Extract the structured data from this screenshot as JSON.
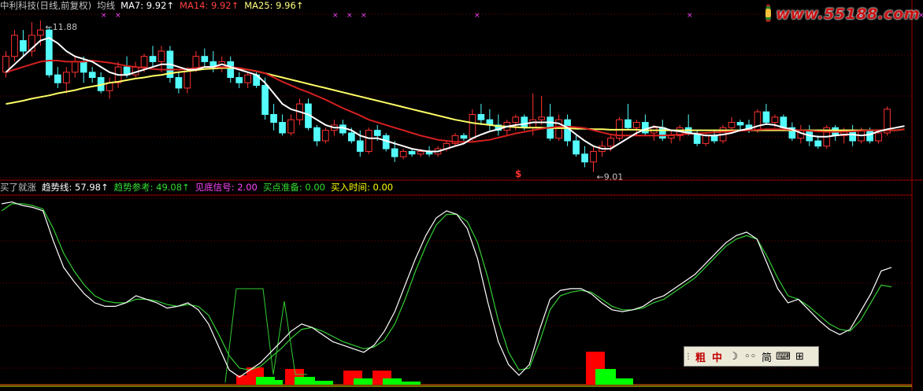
{
  "main_legend": [
    {
      "text": "中利科技(日线,前复权)",
      "color": "#c0c0c0"
    },
    {
      "text": "均线",
      "color": "#c0c0c0"
    },
    {
      "text": "MA7: 9.92↑",
      "color": "#ffffff"
    },
    {
      "text": "MA14: 9.92↑",
      "color": "#ff4040"
    },
    {
      "text": "MA25: 9.96↑",
      "color": "#ffff80"
    }
  ],
  "indicator_legend": [
    {
      "text": "买了就涨",
      "color": "#c0c0c0"
    },
    {
      "text": "趋势线: 57.98↑",
      "color": "#ffffff"
    },
    {
      "text": "趋势参考: 49.08↑",
      "color": "#33dd33"
    },
    {
      "text": "见底信号: 2.00",
      "color": "#ff44ff"
    },
    {
      "text": "买点准备: 0.00",
      "color": "#33dd33"
    },
    {
      "text": "买入时间: 0.00",
      "color": "#ffff00"
    }
  ],
  "annotations": {
    "high": "11.88",
    "low": "9.01",
    "signal_marker": "$"
  },
  "watermark": {
    "text": "www.55188.com"
  },
  "ime_bar": {
    "items": [
      "⋮",
      "粗",
      "中",
      "☽",
      "◦◦",
      "简",
      "⌨",
      "⊞"
    ]
  },
  "colors": {
    "up": "#ff3232",
    "down": "#54fcfc",
    "ma7": "#ffffff",
    "ma14": "#d42020",
    "ma25": "#ffff66",
    "trend": "#ffffff",
    "trend_ref": "#33cc33",
    "grid": "#7a0000",
    "signal": "#ff44ff",
    "bar_red": "#ff0000",
    "bar_green": "#00ff00"
  },
  "chart_data": [
    {
      "type": "candlestick",
      "title": "中利科技(日线,前复权)",
      "ylim": [
        8.9,
        12.0
      ],
      "candles": [
        [
          10.9,
          11.3,
          10.8,
          11.2
        ],
        [
          11.2,
          11.7,
          11.1,
          11.6
        ],
        [
          11.5,
          11.7,
          11.2,
          11.3
        ],
        [
          11.3,
          11.85,
          11.2,
          11.6
        ],
        [
          11.6,
          11.88,
          11.4,
          11.7
        ],
        [
          11.7,
          11.75,
          10.8,
          10.85
        ],
        [
          10.85,
          11.0,
          10.6,
          10.7
        ],
        [
          10.7,
          11.0,
          10.5,
          10.9
        ],
        [
          10.9,
          11.2,
          10.8,
          11.1
        ],
        [
          11.1,
          11.2,
          10.7,
          10.9
        ],
        [
          10.9,
          11.0,
          10.7,
          10.8
        ],
        [
          10.8,
          10.9,
          10.5,
          10.55
        ],
        [
          10.55,
          10.8,
          10.4,
          10.7
        ],
        [
          10.7,
          11.1,
          10.6,
          11.0
        ],
        [
          11.0,
          11.2,
          10.8,
          10.85
        ],
        [
          10.85,
          11.1,
          10.8,
          11.0
        ],
        [
          11.0,
          11.25,
          10.9,
          11.2
        ],
        [
          11.2,
          11.4,
          11.0,
          11.1
        ],
        [
          11.1,
          11.4,
          10.9,
          11.3
        ],
        [
          11.3,
          11.4,
          10.7,
          10.8
        ],
        [
          10.8,
          10.9,
          10.5,
          10.6
        ],
        [
          10.6,
          11.0,
          10.5,
          10.95
        ],
        [
          10.95,
          11.3,
          10.9,
          11.2
        ],
        [
          11.2,
          11.35,
          11.0,
          11.1
        ],
        [
          11.1,
          11.3,
          10.9,
          11.0
        ],
        [
          11.0,
          11.2,
          10.9,
          11.1
        ],
        [
          11.1,
          11.2,
          10.7,
          10.8
        ],
        [
          10.8,
          10.9,
          10.6,
          10.7
        ],
        [
          10.7,
          10.9,
          10.6,
          10.85
        ],
        [
          10.85,
          10.9,
          10.6,
          10.65
        ],
        [
          10.65,
          10.8,
          10.0,
          10.1
        ],
        [
          10.1,
          10.3,
          9.8,
          9.95
        ],
        [
          9.95,
          10.1,
          9.7,
          9.75
        ],
        [
          9.75,
          10.1,
          9.7,
          10.0
        ],
        [
          10.0,
          10.4,
          9.9,
          10.3
        ],
        [
          10.3,
          10.4,
          9.8,
          9.85
        ],
        [
          9.85,
          9.9,
          9.5,
          9.6
        ],
        [
          9.6,
          9.85,
          9.55,
          9.8
        ],
        [
          9.8,
          10.0,
          9.7,
          9.9
        ],
        [
          9.9,
          10.0,
          9.7,
          9.75
        ],
        [
          9.75,
          9.85,
          9.55,
          9.6
        ],
        [
          9.6,
          9.8,
          9.3,
          9.4
        ],
        [
          9.4,
          9.85,
          9.35,
          9.8
        ],
        [
          9.8,
          9.9,
          9.6,
          9.7
        ],
        [
          9.7,
          9.75,
          9.4,
          9.45
        ],
        [
          9.45,
          9.6,
          9.2,
          9.3
        ],
        [
          9.3,
          9.45,
          9.25,
          9.4
        ],
        [
          9.4,
          9.45,
          9.3,
          9.35
        ],
        [
          9.35,
          9.45,
          9.3,
          9.4
        ],
        [
          9.4,
          9.5,
          9.3,
          9.35
        ],
        [
          9.35,
          9.5,
          9.3,
          9.45
        ],
        [
          9.45,
          9.6,
          9.4,
          9.55
        ],
        [
          9.55,
          9.75,
          9.5,
          9.7
        ],
        [
          9.7,
          9.75,
          9.6,
          9.65
        ],
        [
          9.65,
          10.2,
          9.6,
          10.1
        ],
        [
          10.1,
          10.3,
          9.9,
          10.0
        ],
        [
          10.0,
          10.2,
          9.8,
          9.9
        ],
        [
          9.9,
          10.1,
          9.7,
          9.8
        ],
        [
          9.8,
          10.0,
          9.7,
          9.95
        ],
        [
          9.95,
          10.1,
          9.8,
          10.05
        ],
        [
          10.05,
          10.1,
          9.8,
          9.85
        ],
        [
          9.85,
          10.5,
          9.7,
          10.0
        ],
        [
          10.0,
          10.45,
          9.9,
          10.05
        ],
        [
          10.05,
          10.3,
          9.6,
          9.65
        ],
        [
          9.65,
          10.1,
          9.6,
          10.0
        ],
        [
          10.0,
          10.1,
          9.5,
          9.6
        ],
        [
          9.6,
          9.7,
          9.3,
          9.35
        ],
        [
          9.35,
          9.5,
          9.1,
          9.2
        ],
        [
          9.2,
          9.5,
          9.01,
          9.4
        ],
        [
          9.4,
          9.6,
          9.3,
          9.5
        ],
        [
          9.5,
          9.7,
          9.4,
          9.65
        ],
        [
          9.65,
          10.05,
          9.6,
          10.0
        ],
        [
          10.0,
          10.3,
          9.8,
          9.85
        ],
        [
          9.85,
          10.0,
          9.7,
          9.95
        ],
        [
          9.95,
          10.1,
          9.7,
          9.75
        ],
        [
          9.75,
          9.9,
          9.6,
          9.85
        ],
        [
          9.85,
          10.0,
          9.6,
          9.65
        ],
        [
          9.65,
          9.8,
          9.55,
          9.7
        ],
        [
          9.7,
          9.9,
          9.6,
          9.85
        ],
        [
          9.85,
          10.1,
          9.7,
          9.75
        ],
        [
          9.75,
          9.8,
          9.5,
          9.55
        ],
        [
          9.55,
          9.75,
          9.5,
          9.7
        ],
        [
          9.7,
          9.8,
          9.55,
          9.6
        ],
        [
          9.6,
          9.9,
          9.55,
          9.85
        ],
        [
          9.85,
          10.05,
          9.8,
          9.95
        ],
        [
          9.95,
          10.0,
          9.8,
          9.9
        ],
        [
          9.9,
          10.0,
          9.75,
          9.8
        ],
        [
          9.8,
          10.2,
          9.75,
          10.15
        ],
        [
          10.15,
          10.3,
          9.9,
          9.95
        ],
        [
          9.95,
          10.1,
          9.85,
          10.05
        ],
        [
          10.05,
          10.1,
          9.8,
          9.85
        ],
        [
          9.85,
          9.95,
          9.6,
          9.65
        ],
        [
          9.65,
          9.9,
          9.55,
          9.8
        ],
        [
          9.8,
          9.9,
          9.5,
          9.6
        ],
        [
          9.6,
          9.7,
          9.45,
          9.5
        ],
        [
          9.5,
          9.9,
          9.45,
          9.85
        ],
        [
          9.85,
          9.9,
          9.6,
          9.7
        ],
        [
          9.7,
          9.85,
          9.55,
          9.8
        ],
        [
          9.8,
          9.9,
          9.5,
          9.6
        ],
        [
          9.6,
          9.85,
          9.55,
          9.8
        ],
        [
          9.8,
          9.85,
          9.55,
          9.6
        ],
        [
          9.6,
          9.8,
          9.55,
          9.75
        ],
        [
          9.75,
          10.25,
          9.7,
          10.2
        ]
      ],
      "ma7": [
        10.9,
        11.05,
        11.2,
        11.35,
        11.5,
        11.55,
        11.45,
        11.3,
        11.2,
        11.15,
        11.1,
        11.0,
        10.9,
        10.85,
        10.85,
        10.9,
        10.95,
        11.0,
        11.05,
        11.05,
        11.0,
        10.95,
        10.95,
        11.0,
        11.0,
        11.05,
        11.0,
        10.95,
        10.9,
        10.85,
        10.7,
        10.5,
        10.3,
        10.2,
        10.15,
        10.1,
        10.0,
        9.9,
        9.85,
        9.85,
        9.8,
        9.7,
        9.65,
        9.65,
        9.6,
        9.55,
        9.5,
        9.45,
        9.42,
        9.4,
        9.4,
        9.45,
        9.5,
        9.55,
        9.65,
        9.72,
        9.78,
        9.82,
        9.87,
        9.9,
        9.92,
        9.95,
        9.95,
        9.95,
        9.93,
        9.85,
        9.72,
        9.6,
        9.5,
        9.45,
        9.45,
        9.55,
        9.65,
        9.75,
        9.82,
        9.87,
        9.85,
        9.8,
        9.78,
        9.75,
        9.73,
        9.7,
        9.7,
        9.72,
        9.75,
        9.8,
        9.83,
        9.88,
        9.92,
        9.9,
        9.85,
        9.82,
        9.75,
        9.7,
        9.68,
        9.68,
        9.7,
        9.72,
        9.72,
        9.7,
        9.72,
        9.78,
        9.82,
        9.85,
        9.88
      ],
      "ma14": [
        10.9,
        10.95,
        11.0,
        11.05,
        11.1,
        11.12,
        11.12,
        11.1,
        11.1,
        11.1,
        11.12,
        11.1,
        11.08,
        11.05,
        11.02,
        11.0,
        10.98,
        10.96,
        10.95,
        10.95,
        10.95,
        10.96,
        10.98,
        11.0,
        11.0,
        11.0,
        11.0,
        10.98,
        10.95,
        10.92,
        10.88,
        10.8,
        10.72,
        10.65,
        10.58,
        10.52,
        10.45,
        10.38,
        10.3,
        10.22,
        10.15,
        10.08,
        10.0,
        9.95,
        9.9,
        9.85,
        9.8,
        9.75,
        9.7,
        9.66,
        9.62,
        9.6,
        9.58,
        9.58,
        9.58,
        9.6,
        9.62,
        9.66,
        9.7,
        9.74,
        9.77,
        9.8,
        9.83,
        9.85,
        9.87,
        9.87,
        9.86,
        9.84,
        9.8,
        9.76,
        9.72,
        9.7,
        9.7,
        9.7,
        9.7,
        9.7,
        9.7,
        9.71,
        9.72,
        9.73,
        9.74,
        9.75,
        9.76,
        9.77,
        9.78,
        9.79,
        9.8,
        9.81,
        9.82,
        9.82,
        9.82,
        9.81,
        9.8,
        9.79,
        9.78,
        9.77,
        9.77,
        9.77,
        9.78,
        9.79,
        9.8,
        9.8,
        9.8,
        9.8,
        9.82
      ],
      "ma25": [
        10.3,
        10.33,
        10.36,
        10.4,
        10.43,
        10.46,
        10.5,
        10.53,
        10.56,
        10.6,
        10.63,
        10.66,
        10.7,
        10.72,
        10.75,
        10.78,
        10.8,
        10.83,
        10.85,
        10.88,
        10.9,
        10.92,
        10.94,
        10.96,
        10.97,
        10.98,
        10.98,
        10.97,
        10.95,
        10.92,
        10.88,
        10.84,
        10.8,
        10.76,
        10.72,
        10.68,
        10.64,
        10.6,
        10.56,
        10.52,
        10.48,
        10.44,
        10.4,
        10.36,
        10.32,
        10.28,
        10.24,
        10.2,
        10.16,
        10.12,
        10.08,
        10.04,
        10.0,
        9.97,
        9.94,
        9.92,
        9.9,
        9.88,
        9.87,
        9.86,
        9.85,
        9.85,
        9.85,
        9.84,
        9.84,
        9.84,
        9.83,
        9.83,
        9.82,
        9.82,
        9.81,
        9.81,
        9.81,
        9.81,
        9.8,
        9.8,
        9.8,
        9.8,
        9.8,
        9.8,
        9.8,
        9.8,
        9.8,
        9.8,
        9.8,
        9.8,
        9.8,
        9.8,
        9.8,
        9.8,
        9.8,
        9.8,
        9.8,
        9.8,
        9.8,
        9.8,
        9.8,
        9.8,
        9.8,
        9.8,
        9.8,
        9.8,
        9.8,
        9.8,
        9.82
      ]
    },
    {
      "type": "line",
      "title": "买了就涨",
      "ylim": [
        -5,
        100
      ],
      "series": [
        {
          "name": "趋势线",
          "values": [
            96,
            97,
            95,
            94,
            92,
            75,
            60,
            52,
            45,
            40,
            38,
            38,
            40,
            44,
            42,
            40,
            37,
            38,
            40,
            36,
            28,
            15,
            2,
            -2,
            2,
            6,
            12,
            18,
            24,
            28,
            26,
            22,
            18,
            16,
            14,
            12,
            16,
            24,
            35,
            50,
            65,
            78,
            88,
            92,
            90,
            82,
            65,
            40,
            18,
            5,
            -1,
            5,
            25,
            42,
            47,
            48,
            48,
            45,
            40,
            36,
            35,
            36,
            38,
            42,
            44,
            48,
            52,
            56,
            62,
            68,
            74,
            78,
            80,
            76,
            62,
            48,
            40,
            42,
            36,
            30,
            25,
            22,
            25,
            35,
            45,
            58,
            60
          ]
        },
        {
          "name": "趋势参考",
          "values": [
            92,
            96,
            96,
            95,
            93,
            82,
            68,
            58,
            50,
            44,
            41,
            40,
            40,
            42,
            42,
            41,
            39,
            38,
            39,
            38,
            33,
            22,
            10,
            3,
            2,
            4,
            9,
            14,
            20,
            25,
            26,
            24,
            21,
            18,
            16,
            14,
            15,
            19,
            28,
            42,
            58,
            72,
            84,
            90,
            90,
            86,
            74,
            54,
            30,
            12,
            2,
            3,
            18,
            36,
            44,
            46,
            47,
            46,
            42,
            38,
            36,
            36,
            37,
            40,
            42,
            46,
            50,
            54,
            60,
            66,
            72,
            76,
            78,
            76,
            66,
            54,
            44,
            42,
            38,
            33,
            28,
            25,
            24,
            30,
            40,
            50,
            49
          ]
        },
        {
          "name": "见底信号",
          "values": [
            0,
            0,
            0,
            0,
            0,
            0,
            0,
            0,
            0,
            0,
            0,
            0,
            0,
            0,
            0,
            0,
            0,
            0,
            0,
            0,
            0,
            0,
            0,
            0,
            0,
            0,
            0,
            0,
            0,
            0,
            0,
            0,
            0,
            0,
            0,
            0,
            0,
            0,
            0,
            0,
            0,
            0,
            0,
            0,
            0,
            0,
            0,
            0,
            0,
            0,
            0,
            0,
            0,
            0,
            0,
            0,
            0,
            0,
            0,
            0,
            0,
            0,
            0,
            0,
            0,
            0,
            0,
            0,
            0,
            0,
            0,
            0,
            0,
            0,
            0,
            0,
            0,
            0,
            0,
            0,
            0,
            0,
            0,
            0,
            0,
            0,
            2
          ]
        }
      ]
    }
  ]
}
